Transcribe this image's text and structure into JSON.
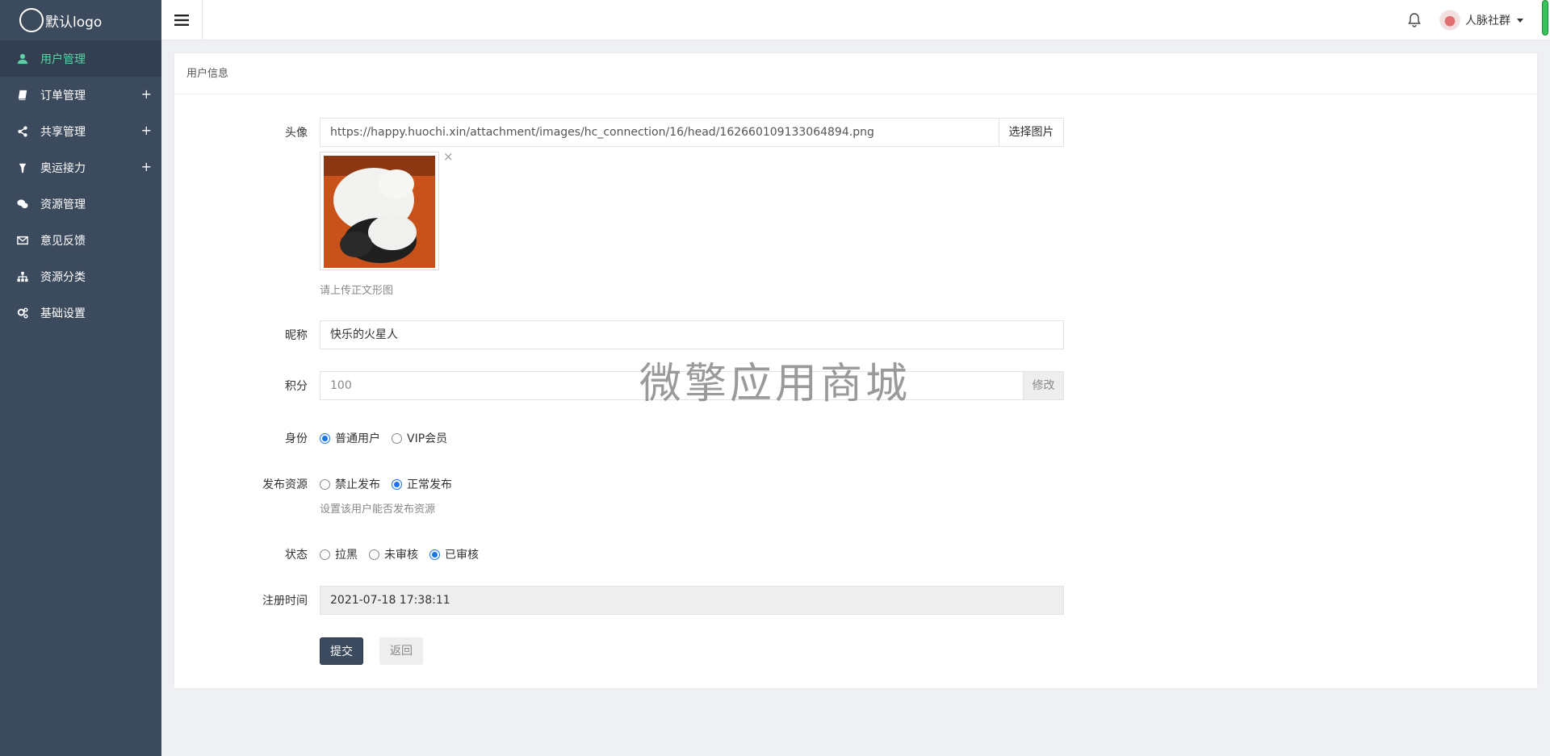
{
  "app": {
    "logo_text": "默认logo"
  },
  "sidebar": {
    "items": [
      {
        "label": "用户管理",
        "icon": "user-icon",
        "active": true,
        "expandable": false
      },
      {
        "label": "订单管理",
        "icon": "book-icon",
        "active": false,
        "expandable": true
      },
      {
        "label": "共享管理",
        "icon": "share-icon",
        "active": false,
        "expandable": true
      },
      {
        "label": "奥运接力",
        "icon": "torch-icon",
        "active": false,
        "expandable": true
      },
      {
        "label": "资源管理",
        "icon": "wechat-icon",
        "active": false,
        "expandable": false
      },
      {
        "label": "意见反馈",
        "icon": "envelope-icon",
        "active": false,
        "expandable": false
      },
      {
        "label": "资源分类",
        "icon": "sitemap-icon",
        "active": false,
        "expandable": false
      },
      {
        "label": "基础设置",
        "icon": "cogs-icon",
        "active": false,
        "expandable": false
      }
    ],
    "plus": "+"
  },
  "header": {
    "user_name": "人脉社群"
  },
  "card": {
    "title": "用户信息"
  },
  "form": {
    "avatar": {
      "label": "头像",
      "url": "https://happy.huochi.xin/attachment/images/hc_connection/16/head/162660109133064894.png",
      "select_button": "选择图片",
      "remove": "×",
      "hint": "请上传正文形图"
    },
    "nickname": {
      "label": "昵称",
      "value": "快乐的火星人"
    },
    "points": {
      "label": "积分",
      "value": "100",
      "edit_button": "修改"
    },
    "identity": {
      "label": "身份",
      "options": [
        {
          "label": "普通用户",
          "checked": true
        },
        {
          "label": "VIP会员",
          "checked": false
        }
      ]
    },
    "publish": {
      "label": "发布资源",
      "options": [
        {
          "label": "禁止发布",
          "checked": false
        },
        {
          "label": "正常发布",
          "checked": true
        }
      ],
      "hint": "设置该用户能否发布资源"
    },
    "status": {
      "label": "状态",
      "options": [
        {
          "label": "拉黑",
          "checked": false
        },
        {
          "label": "未审核",
          "checked": false
        },
        {
          "label": "已审核",
          "checked": true
        }
      ]
    },
    "register_time": {
      "label": "注册时间",
      "value": "2021-07-18 17:38:11"
    },
    "submit": "提交",
    "back": "返回"
  },
  "watermark": "微擎应用商城",
  "colors": {
    "sidebar_bg": "#3c4a5d",
    "active_text": "#5ed1a4",
    "primary_button": "#3b4a5e",
    "radio_checked": "#1a73e8"
  }
}
